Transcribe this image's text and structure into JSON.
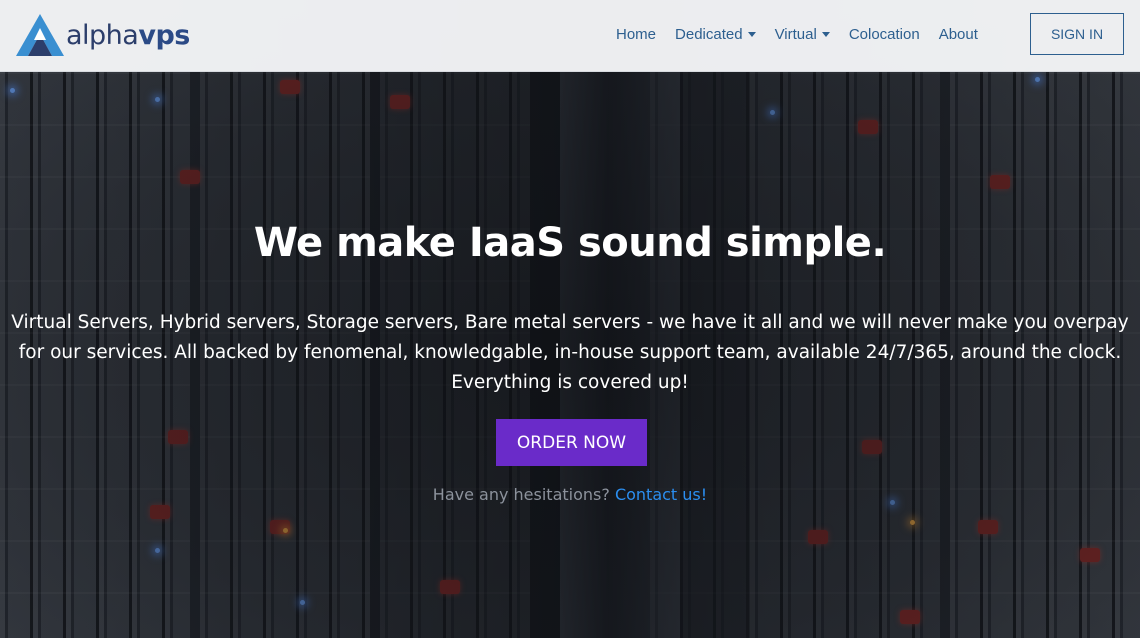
{
  "brand": {
    "name_part1": "alpha",
    "name_part2": "vps",
    "logo_icon": "alphavps-logo-icon"
  },
  "nav": {
    "items": [
      {
        "label": "Home",
        "has_dropdown": false
      },
      {
        "label": "Dedicated",
        "has_dropdown": true
      },
      {
        "label": "Virtual",
        "has_dropdown": true
      },
      {
        "label": "Colocation",
        "has_dropdown": false
      },
      {
        "label": "About",
        "has_dropdown": false
      }
    ],
    "signin_label": "SIGN IN"
  },
  "hero": {
    "headline": "We make IaaS sound simple.",
    "description": "Virtual Servers, Hybrid servers, Storage servers, Bare metal servers - we have it all and we will never make you overpay for our services. All backed by fenomenal, knowledgable, in-house support team, available 24/7/365, around the clock. Everything is covered up!",
    "cta_label": "ORDER NOW",
    "hesitation_text": "Have any hesitations?",
    "contact_label": "Contact us!"
  },
  "colors": {
    "brand_dark": "#2c3e6b",
    "nav_link": "#2d5f8f",
    "cta_purple": "#6a2bc9",
    "link_blue": "#2b8ef0",
    "muted_text": "#8c929c"
  }
}
